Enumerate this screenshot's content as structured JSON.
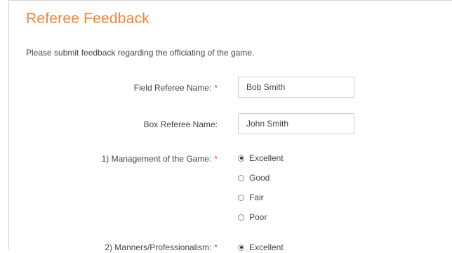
{
  "page": {
    "title": "Referee Feedback",
    "intro": "Please submit feedback regarding the officiating of the game."
  },
  "fields": {
    "field_referee": {
      "label": "Field Referee Name:",
      "required": "*",
      "value": "Bob Smith"
    },
    "box_referee": {
      "label": "Box Referee Name:",
      "value": "John Smith"
    }
  },
  "questions": [
    {
      "label": "1) Management of the Game:",
      "required": "*",
      "options": [
        "Excellent",
        "Good",
        "Fair",
        "Poor"
      ],
      "selected": "Excellent"
    },
    {
      "label": "2) Manners/Professionalism:",
      "required": "*",
      "options": [
        "Excellent"
      ],
      "selected": "Excellent"
    }
  ],
  "colors": {
    "title": "#f0843a",
    "required": "#e03a3a"
  }
}
